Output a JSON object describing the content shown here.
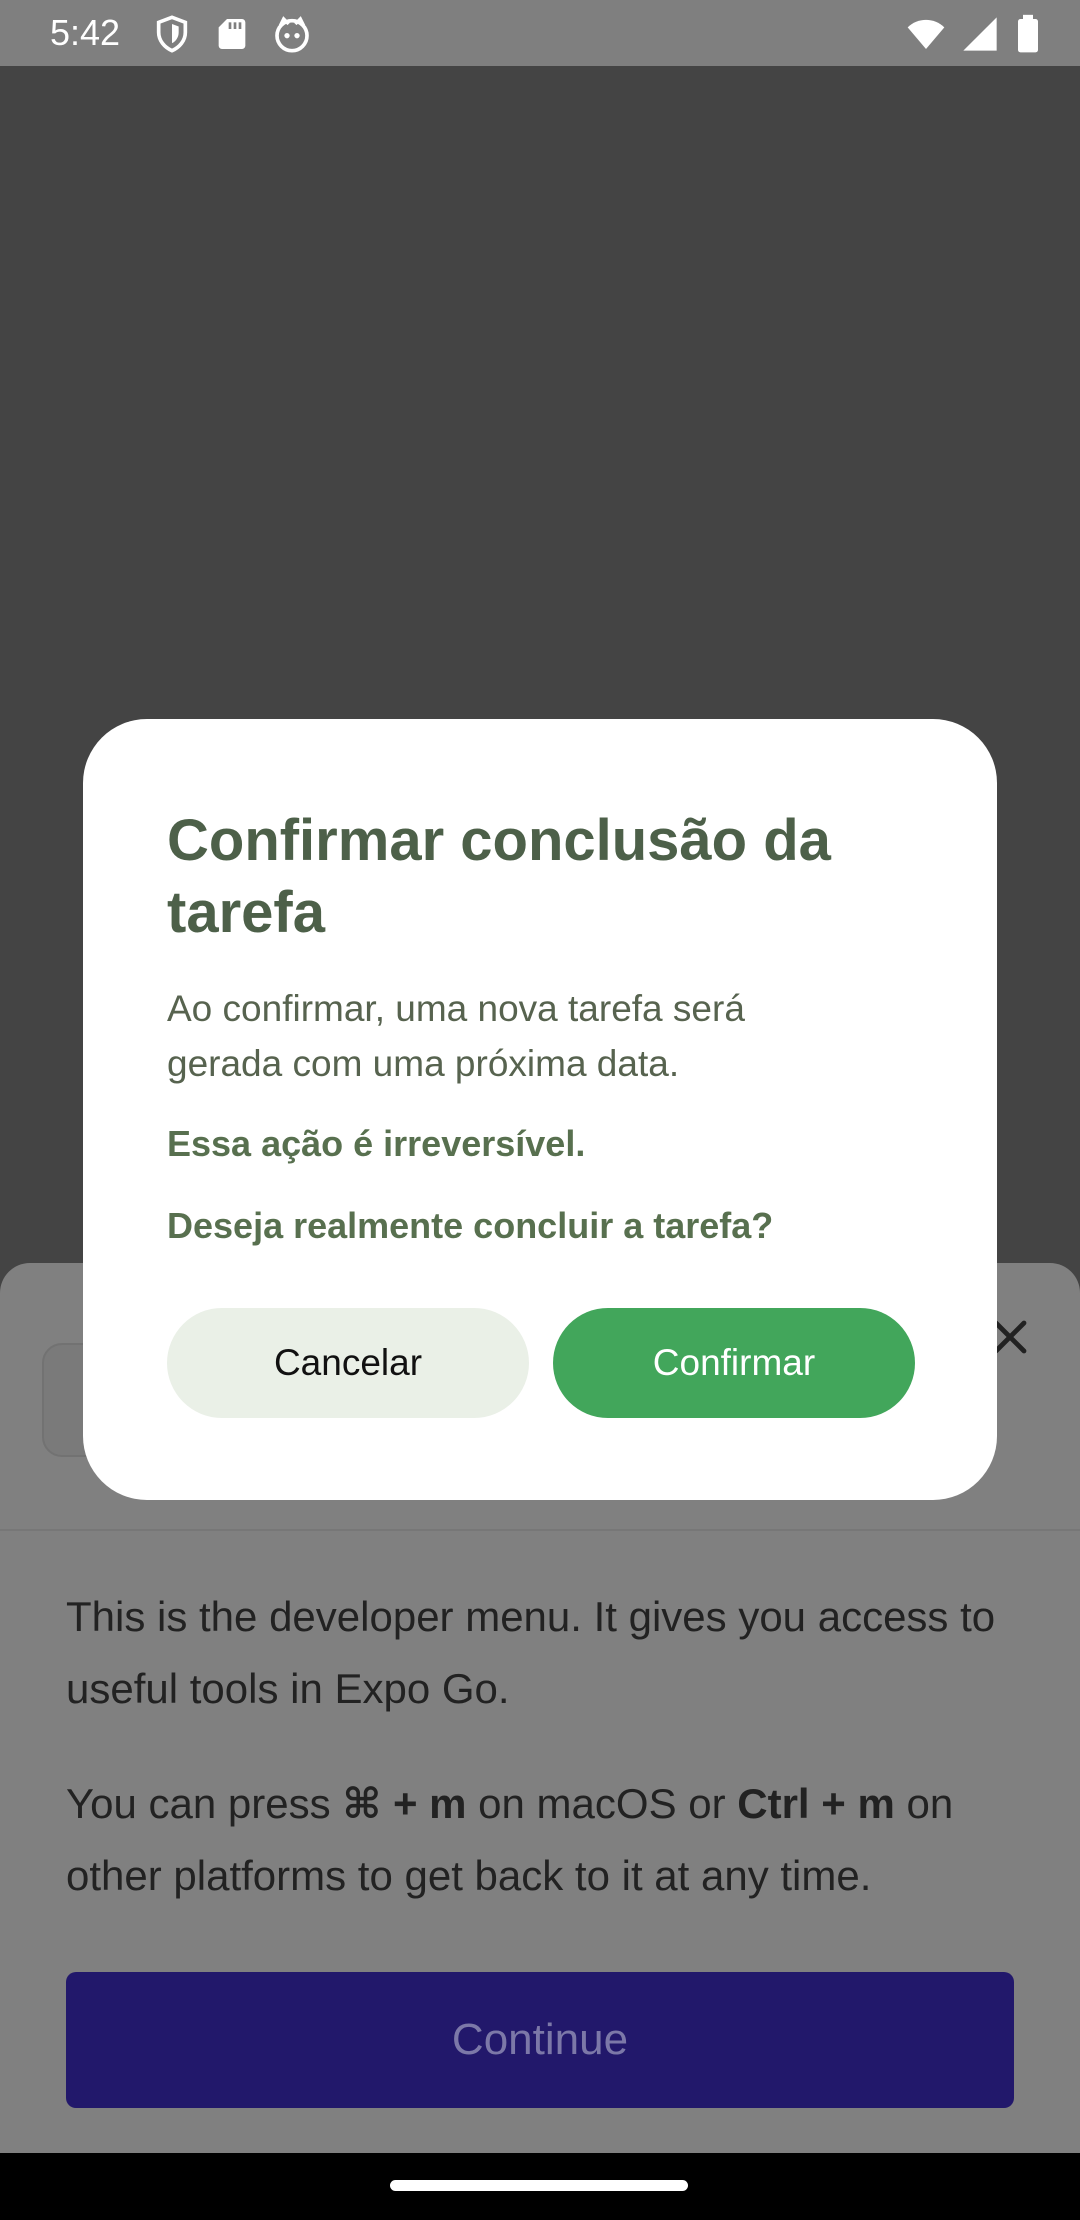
{
  "status_bar": {
    "time": "5:42",
    "left_icons": [
      "shield-icon",
      "sd-card-icon",
      "cat-face-icon"
    ],
    "right_icons": [
      "wifi-icon",
      "cell-signal-icon",
      "battery-icon"
    ]
  },
  "dialog": {
    "title": "Confirmar conclusão da tarefa",
    "message": "Ao confirmar, uma nova tarefa será gerada com uma próxima data.",
    "warning": "Essa ação é irreversível.",
    "question": "Deseja realmente concluir a tarefa?",
    "cancel_label": "Cancelar",
    "confirm_label": "Confirmar",
    "confirm_color": "#42a65b",
    "cancel_color": "#eaf0e7"
  },
  "dev_menu": {
    "intro": "This is the developer menu. It gives you access to useful tools in Expo Go.",
    "shortcut_prefix": "You can press ",
    "shortcut_mac": "⌘ + m",
    "shortcut_mid": " on macOS or ",
    "shortcut_other": "Ctrl + m",
    "shortcut_suffix": " on other platforms to get back to it at any time.",
    "continue_label": "Continue",
    "continue_color": "#22186b"
  }
}
